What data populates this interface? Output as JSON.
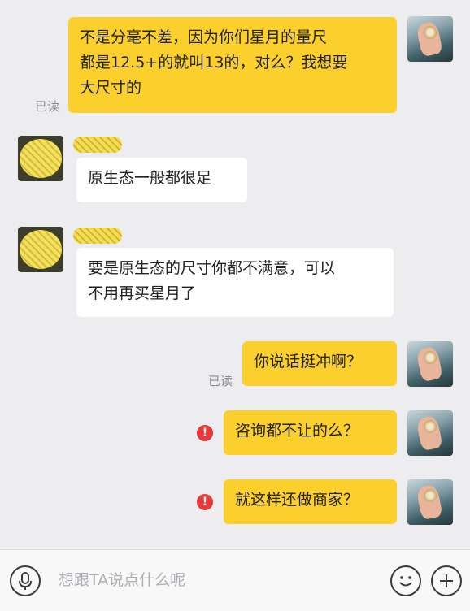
{
  "messages": [
    {
      "side": "self",
      "text": "不是分毫不差，因为你们星月的量尺\n都是12.5+的就叫13的，对么？我想要\n大尺寸的",
      "status": "已读"
    },
    {
      "side": "other",
      "text": "原生态一般都很足"
    },
    {
      "side": "other",
      "text": "要是原生态的尺寸你都不满意，可以\n不用再买星月了"
    },
    {
      "side": "self",
      "text": "你说话挺冲啊？",
      "status": "已读"
    },
    {
      "side": "self",
      "text": "咨询都不让的么？",
      "status_icon": "send-failed-icon"
    },
    {
      "side": "self",
      "text": "就这样还做商家？",
      "status_icon": "send-failed-icon"
    }
  ],
  "input_bar": {
    "placeholder": "想跟TA说点什么呢",
    "voice_icon": "microphone-icon",
    "emoji_icon": "smiley-icon",
    "more_icon": "plus-icon"
  },
  "colors": {
    "self_bubble": "#fbd02c",
    "other_bubble": "#ffffff",
    "background": "#ededf0",
    "error": "#e5393a"
  }
}
